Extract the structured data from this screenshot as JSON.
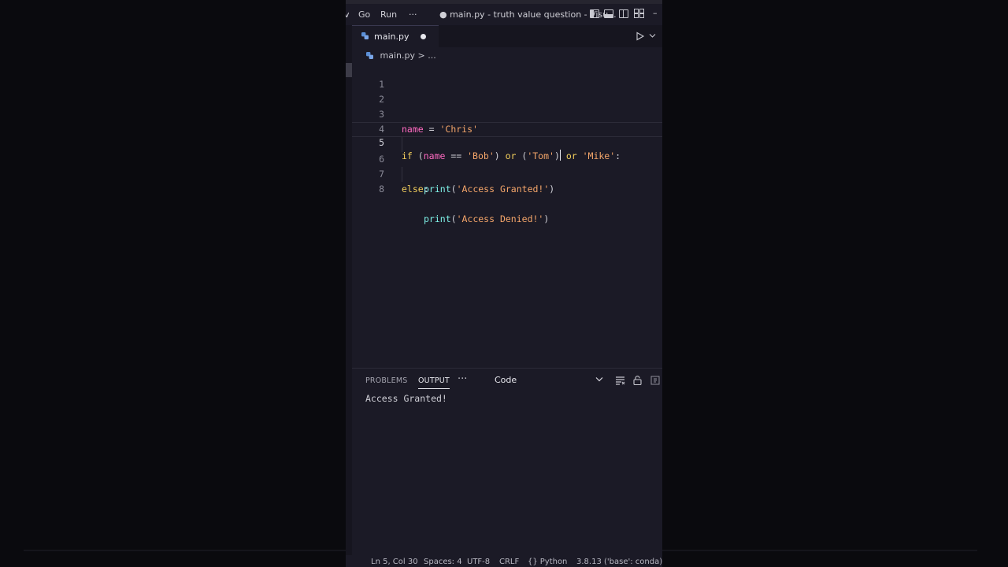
{
  "titlebar": {
    "menu_view_fragment": "v",
    "menu_go": "Go",
    "menu_run": "Run",
    "menu_more": "···",
    "title": "● main.py - truth value question - Visu...",
    "minimize": "–"
  },
  "tab": {
    "label": "main.py",
    "modified_dot": true
  },
  "breadcrumb": {
    "file": "main.py",
    "separator": ">",
    "rest": "..."
  },
  "editor": {
    "lines": [
      {
        "num": "1"
      },
      {
        "num": "2"
      },
      {
        "num": "3",
        "tokens": {
          "var": "name",
          "op": " = ",
          "str": "'Chris'"
        }
      },
      {
        "num": "4"
      },
      {
        "num": "5",
        "tokens": {
          "if": "if",
          "p1": " (",
          "var": "name",
          "eq": " == ",
          "s1": "'Bob'",
          "p2": ")",
          "or1": " or ",
          "p3": "(",
          "s2": "'Tom'",
          "p4": ")",
          "or2": " or ",
          "s3": "'Mike'",
          "colon": ":"
        }
      },
      {
        "num": "6",
        "tokens": {
          "fn": "print",
          "p1": "(",
          "str": "'Access Granted!'",
          "p2": ")"
        }
      },
      {
        "num": "7",
        "tokens": {
          "kw": "else",
          "colon": ":"
        }
      },
      {
        "num": "8",
        "tokens": {
          "fn": "print",
          "p1": "(",
          "str": "'Access Denied!'",
          "p2": ")"
        }
      }
    ]
  },
  "panel": {
    "tabs": [
      "PROBLEMS",
      "OUTPUT"
    ],
    "active_tab": "OUTPUT",
    "more": "···",
    "dropdown_value": "Code",
    "output": "Access Granted!"
  },
  "status": {
    "position": "Ln 5, Col 30",
    "spaces": "Spaces: 4",
    "encoding": "UTF-8",
    "eol": "CRLF",
    "language": "Python",
    "interpreter": "3.8.13 ('base': conda)"
  },
  "colors": {
    "background": "#1b1a26",
    "keyword": "#f2ce5c",
    "variable": "#ff6ac1",
    "string": "#f5a66a",
    "function": "#7ef0e6"
  }
}
